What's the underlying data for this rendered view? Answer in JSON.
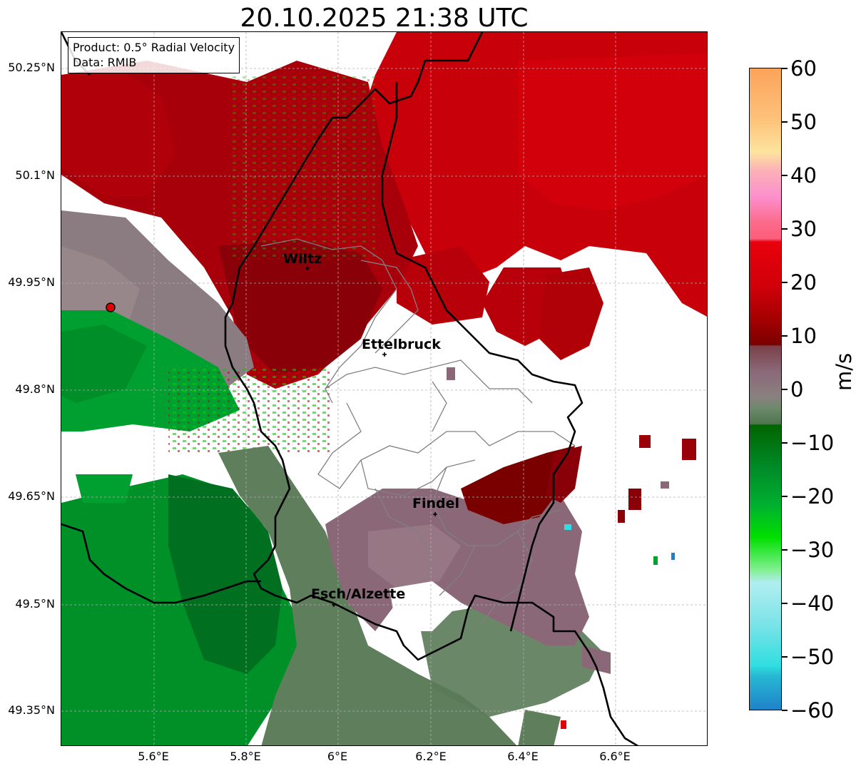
{
  "title": "20.10.2025 21:38 UTC",
  "info": {
    "product": "Product: 0.5° Radial Velocity",
    "source": "Data: RMIB"
  },
  "axes": {
    "lat_labels": [
      "50.25°N",
      "50.1°N",
      "49.95°N",
      "49.8°N",
      "49.65°N",
      "49.5°N",
      "49.35°N"
    ],
    "lon_labels": [
      "5.6°E",
      "5.8°E",
      "6°E",
      "6.2°E",
      "6.4°E",
      "6.6°E"
    ]
  },
  "places": [
    "Wiltz",
    "Ettelbruck",
    "Findel",
    "Esch/Alzette"
  ],
  "colorbar": {
    "unit": "m/s",
    "ticks": [
      "60",
      "50",
      "40",
      "30",
      "20",
      "10",
      "0",
      "−10",
      "−20",
      "−30",
      "−40",
      "−50",
      "−60"
    ],
    "colors": {
      "orange": "#fca35a",
      "light_orange": "#fdc27b",
      "pale_yellow": "#fde49d",
      "pink": "#fc8fcd",
      "salmon": "#fc5e7b",
      "red": "#e8000b",
      "dark_red": "#9a0000",
      "maroon": "#7a0000",
      "mauve": "#8a6070",
      "grey": "#8a8080",
      "grey_green": "#6a8a6a",
      "dark_green": "#006400",
      "green": "#00a030",
      "bright_green": "#00e000",
      "light_green": "#80f090",
      "pale_cyan": "#b0eef0",
      "cyan": "#30dde0",
      "blue": "#1e80c8"
    }
  },
  "radar_site_color": "#e00000"
}
